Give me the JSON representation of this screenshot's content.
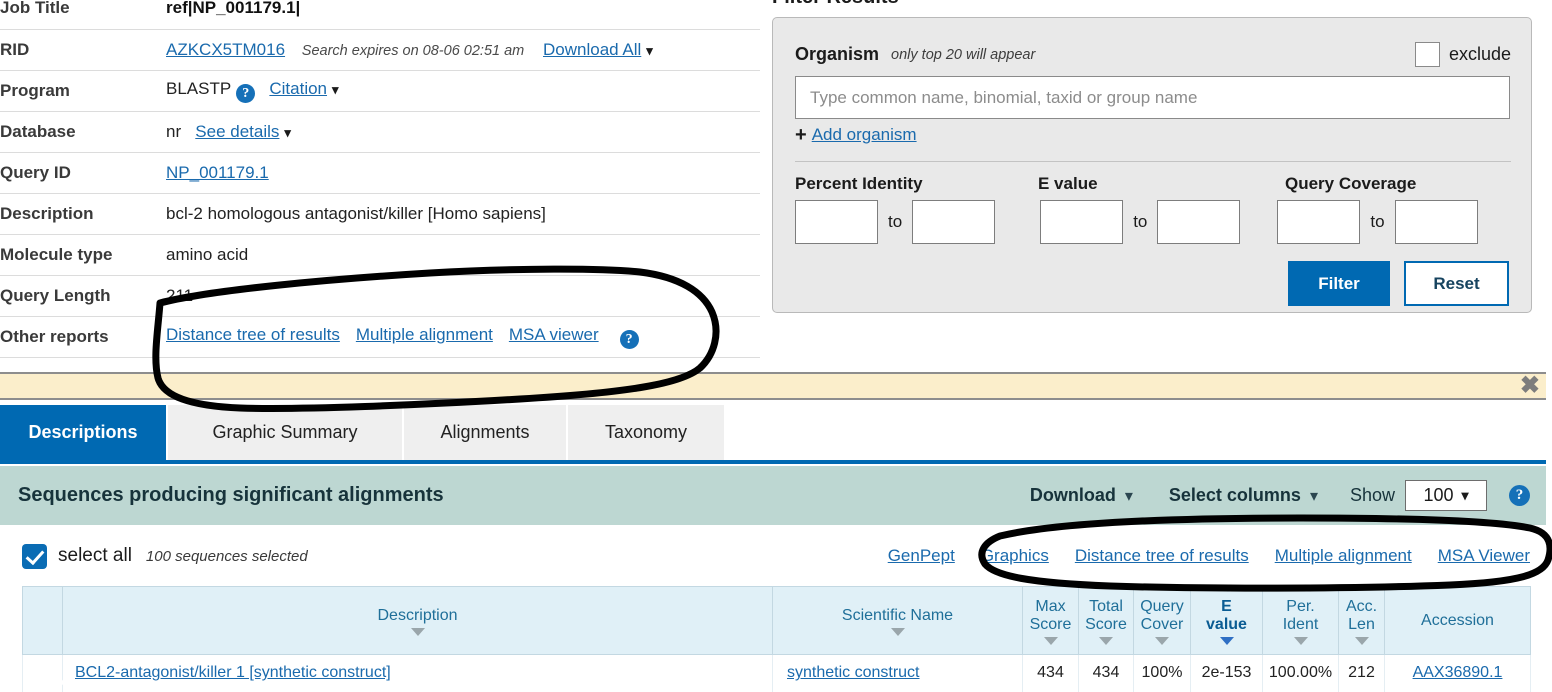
{
  "info": {
    "rows": [
      {
        "label": "Job Title",
        "type": "bold",
        "value": "ref|NP_001179.1|"
      },
      {
        "label": "RID",
        "type": "rid",
        "value": "AZKCX5TM016",
        "expires": "Search expires on 08-06 02:51 am",
        "download_all": "Download All"
      },
      {
        "label": "Program",
        "type": "program",
        "value": "BLASTP",
        "citation": "Citation"
      },
      {
        "label": "Database",
        "type": "database",
        "value": "nr",
        "see_details": "See details"
      },
      {
        "label": "Query ID",
        "type": "link",
        "value": "NP_001179.1"
      },
      {
        "label": "Description",
        "type": "text",
        "value": "bcl-2 homologous antagonist/killer [Homo sapiens]"
      },
      {
        "label": "Molecule type",
        "type": "text",
        "value": "amino acid"
      },
      {
        "label": "Query Length",
        "type": "text",
        "value": "211"
      },
      {
        "label": "Other reports",
        "type": "reports",
        "links": [
          "Distance tree of results",
          "Multiple alignment",
          "MSA viewer"
        ]
      }
    ]
  },
  "filter": {
    "title": "Filter Results",
    "organism_label": "Organism",
    "organism_note": "only top 20 will appear",
    "exclude_label": "exclude",
    "organism_placeholder": "Type common  name, binomial, taxid or group  name",
    "organism_value": "",
    "add_organism": "Add organism",
    "percent_identity_label": "Percent Identity",
    "evalue_label": "E value",
    "query_coverage_label": "Query Coverage",
    "to_label": "to",
    "percent_identity_from": "",
    "percent_identity_to": "",
    "evalue_from": "",
    "evalue_to": "",
    "query_coverage_from": "",
    "query_coverage_to": "",
    "filter_button": "Filter",
    "reset_button": "Reset"
  },
  "banner": {
    "close_label": "✖"
  },
  "tabs": [
    {
      "label": "Descriptions",
      "active": true
    },
    {
      "label": "Graphic Summary",
      "active": false
    },
    {
      "label": "Alignments",
      "active": false
    },
    {
      "label": "Taxonomy",
      "active": false
    }
  ],
  "results_header": {
    "title": "Sequences producing significant alignments",
    "download": "Download",
    "select_columns": "Select columns",
    "show_label": "Show",
    "show_value": "100"
  },
  "select_row": {
    "select_all_label": "select all",
    "count_text": "100 sequences selected",
    "links": [
      "GenPept",
      "Graphics",
      "Distance tree of results",
      "Multiple alignment",
      "MSA Viewer"
    ]
  },
  "table": {
    "columns": [
      {
        "label": "",
        "sortable": false,
        "sorted": false
      },
      {
        "label": "Description",
        "sortable": true,
        "sorted": false
      },
      {
        "label": "Scientific Name",
        "sortable": true,
        "sorted": false
      },
      {
        "label": "Max\nScore",
        "sortable": true,
        "sorted": false
      },
      {
        "label": "Total\nScore",
        "sortable": true,
        "sorted": false
      },
      {
        "label": "Query\nCover",
        "sortable": true,
        "sorted": false
      },
      {
        "label": "E\nvalue",
        "sortable": true,
        "sorted": true
      },
      {
        "label": "Per.\nIdent",
        "sortable": true,
        "sorted": false
      },
      {
        "label": "Acc.\nLen",
        "sortable": true,
        "sorted": false
      },
      {
        "label": "Accession",
        "sortable": false,
        "sorted": false
      }
    ],
    "rows": [
      {
        "checked": true,
        "description": "BCL2-antagonist/killer 1 [synthetic construct]",
        "scientific_name": "synthetic construct",
        "max_score": "434",
        "total_score": "434",
        "query_cover": "100%",
        "e_value": "2e-153",
        "per_ident": "100.00%",
        "acc_len": "212",
        "accession": "AAX36890.1"
      }
    ]
  },
  "colors": {
    "accent_blue": "#0069b2",
    "link_blue": "#1a6aad",
    "banner_yellow": "#fbeecb",
    "results_header_teal": "#bdd7d2",
    "table_header_blue": "#e0f0f7"
  }
}
